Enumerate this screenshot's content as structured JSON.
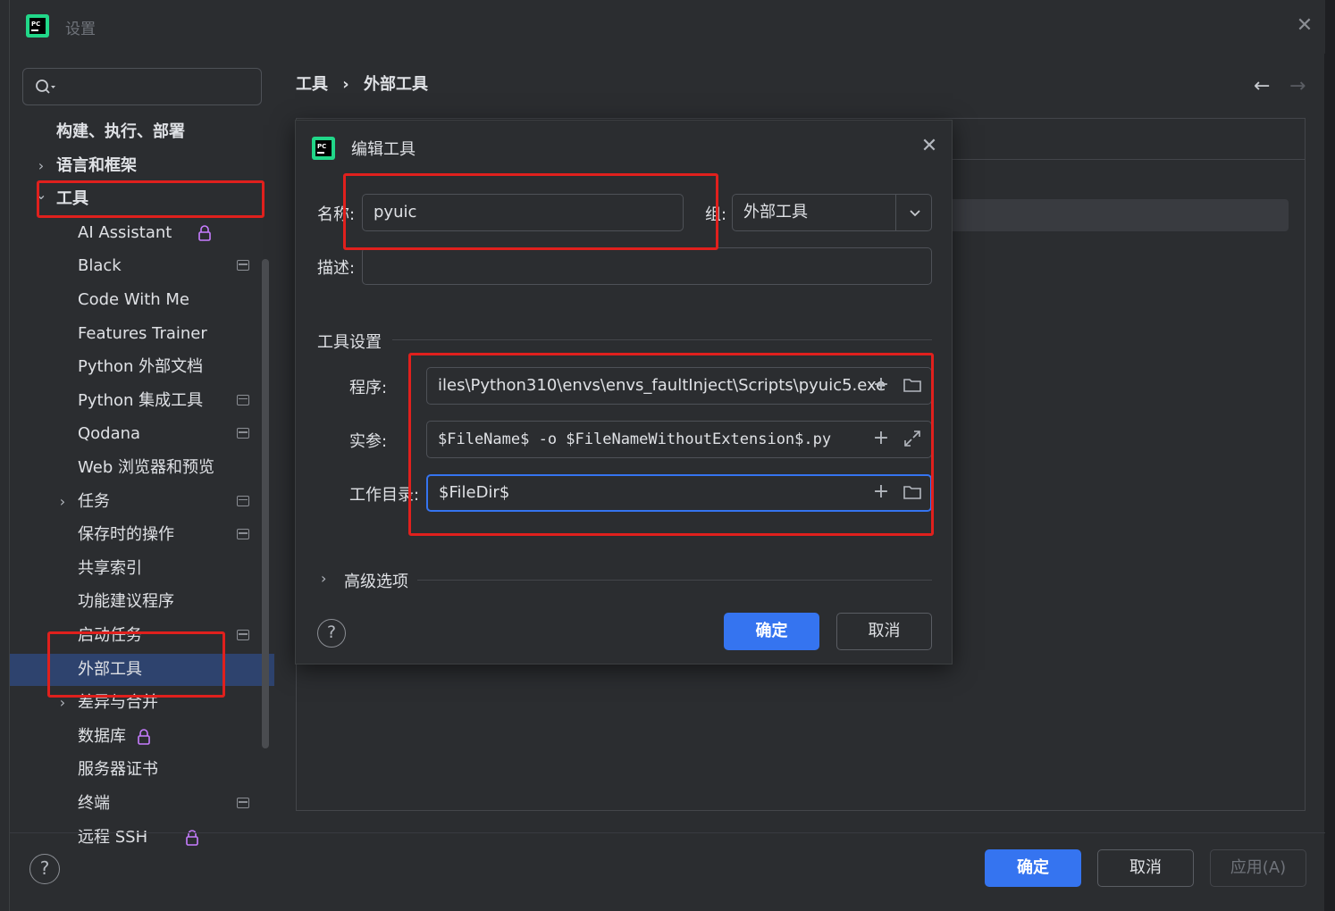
{
  "window": {
    "title": "设置"
  },
  "breadcrumb": [
    "工具",
    "外部工具"
  ],
  "breadcrumb_separator": "›",
  "search": {
    "placeholder": ""
  },
  "sidebar": {
    "items": [
      {
        "label": "构建、执行、部署",
        "bold": true,
        "chevron": ""
      },
      {
        "label": "语言和框架",
        "bold": true,
        "chevron": ">"
      },
      {
        "label": "工具",
        "bold": true,
        "chevron": "v"
      },
      {
        "label": "AI Assistant",
        "locked": true
      },
      {
        "label": "Black",
        "module_icon": true
      },
      {
        "label": "Code With Me"
      },
      {
        "label": "Features Trainer"
      },
      {
        "label": "Python 外部文档"
      },
      {
        "label": "Python 集成工具",
        "module_icon": true
      },
      {
        "label": "Qodana",
        "module_icon": true
      },
      {
        "label": "Web 浏览器和预览"
      },
      {
        "label": "任务",
        "chevron": ">",
        "module_icon": true
      },
      {
        "label": "保存时的操作",
        "module_icon": true
      },
      {
        "label": "共享索引"
      },
      {
        "label": "功能建议程序"
      },
      {
        "label": "启动任务",
        "module_icon": true
      },
      {
        "label": "外部工具",
        "selected": true
      },
      {
        "label": "差异与合并",
        "chevron": ">"
      },
      {
        "label": "数据库",
        "locked": true
      },
      {
        "label": "服务器证书"
      },
      {
        "label": "终端",
        "module_icon": true
      },
      {
        "label": "远程 SSH",
        "locked": true
      }
    ]
  },
  "footer": {
    "help": "?",
    "ok_label": "确定",
    "cancel_label": "取消",
    "apply_label": "应用(A)"
  },
  "dialog": {
    "title": "编辑工具",
    "name_label": "名称:",
    "name_value": "pyuic",
    "group_label": "组:",
    "group_value": "外部工具",
    "description_label": "描述:",
    "description_value": "",
    "tool_settings_label": "工具设置",
    "program_label": "程序:",
    "program_value": "iles\\Python310\\envs\\envs_faultInject\\Scripts\\pyuic5.exe",
    "arguments_label": "实参:",
    "arguments_value": "$FileName$ -o $FileNameWithoutExtension$.py",
    "working_dir_label": "工作目录:",
    "working_dir_value": "$FileDir$",
    "advanced_label": "高级选项",
    "help": "?",
    "ok_label": "确定",
    "cancel_label": "取消"
  },
  "colors": {
    "accent": "#3574f0",
    "highlight_annotation": "#e0201d",
    "selected_row": "#2e436e",
    "lock_icon": "#c77dff"
  },
  "icons": {
    "close": "close-icon",
    "search": "search-icon",
    "back": "arrow-left-icon",
    "forward": "arrow-right-icon",
    "add": "plus-icon",
    "folder": "folder-icon",
    "expand": "expand-icon"
  }
}
